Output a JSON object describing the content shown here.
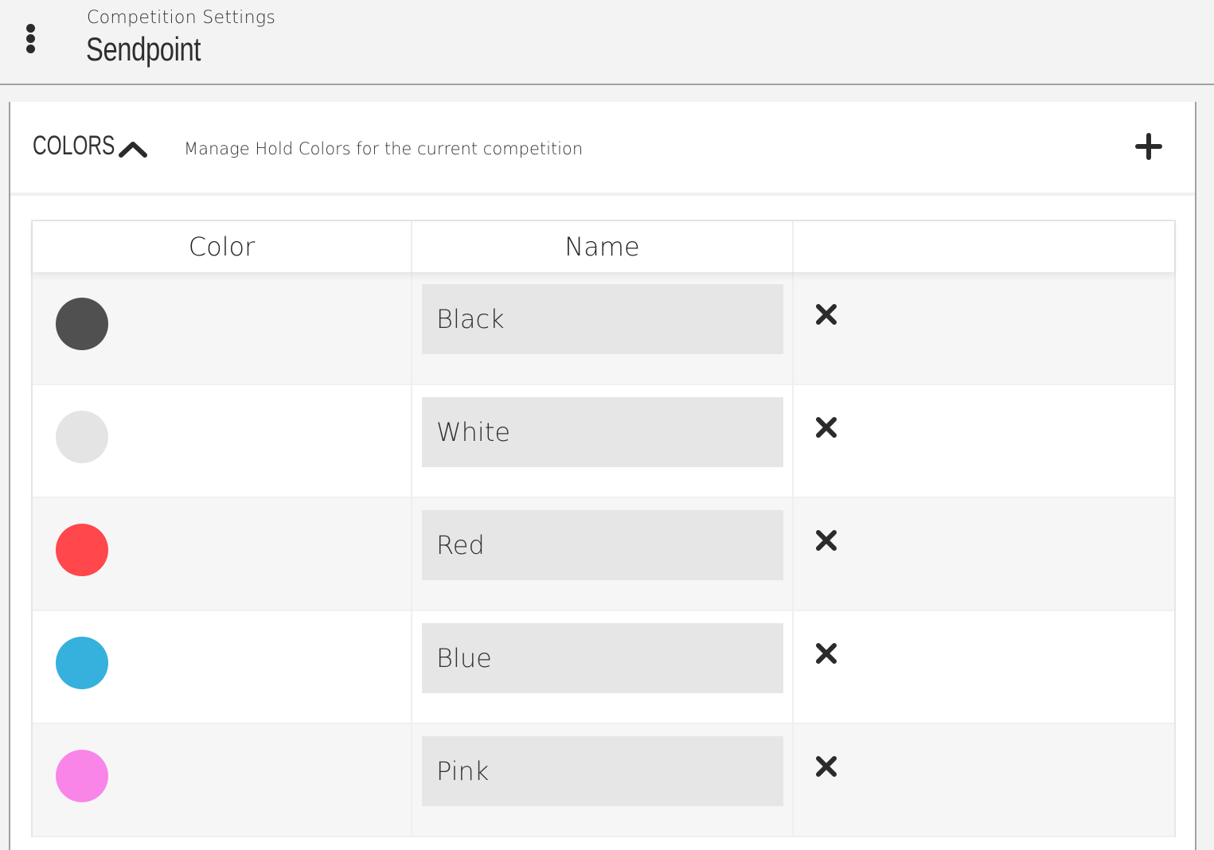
{
  "header": {
    "subtitle": "Competition Settings",
    "title": "Sendpoint",
    "menu_icon": "more-vertical-icon"
  },
  "section": {
    "title": "COLORS",
    "description": "Manage Hold Colors for the current competition",
    "collapse_icon": "chevron-up-icon",
    "add_icon": "plus-icon"
  },
  "table": {
    "columns": [
      "Color",
      "Name",
      ""
    ],
    "rows": [
      {
        "color": "#505050",
        "name": "Black"
      },
      {
        "color": "#e4e4e4",
        "name": "White"
      },
      {
        "color": "#ff474c",
        "name": "Red"
      },
      {
        "color": "#36b0dc",
        "name": "Blue"
      },
      {
        "color": "#f985e9",
        "name": "Pink"
      }
    ],
    "delete_icon": "close-icon"
  }
}
